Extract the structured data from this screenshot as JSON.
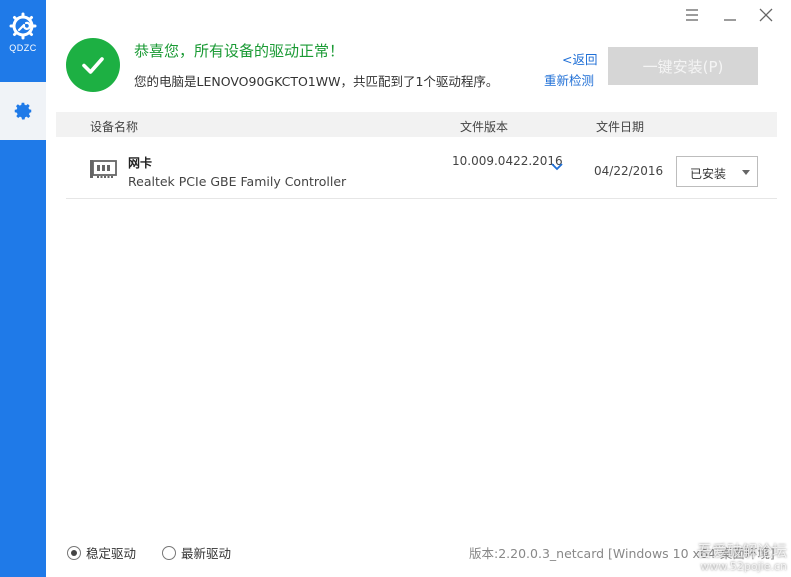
{
  "sidebar": {
    "logo_text": "QDZC",
    "nav": [
      {
        "icon": "gear-icon",
        "active": true
      }
    ]
  },
  "window_controls": [
    "menu-icon",
    "minimize-icon",
    "close-icon"
  ],
  "status": {
    "title": "恭喜您，所有设备的驱动正常！",
    "detail": "您的电脑是LENOVO90GKCTO1WW，共匹配到了1个驱动程序。"
  },
  "links": {
    "back": "<返回",
    "recheck": "重新检测"
  },
  "install_button": "一键安装(P)",
  "table": {
    "headers": {
      "name": "设备名称",
      "version": "文件版本",
      "date": "文件日期"
    },
    "rows": [
      {
        "type": "网卡",
        "name": "Realtek PCIe GBE Family Controller",
        "version": "10.009.0422.2016",
        "date": "04/22/2016",
        "status": "已安装"
      }
    ]
  },
  "footer": {
    "options": [
      {
        "label": "稳定驱动",
        "checked": true
      },
      {
        "label": "最新驱动",
        "checked": false
      }
    ],
    "version_info": "版本:2.20.0.3_netcard [Windows 10 x64 桌面环境]"
  },
  "watermark": {
    "line1": "吾爱破解论坛",
    "line2": "www.52pojie.cn"
  },
  "colors": {
    "sidebar": "#1f7ae8",
    "success": "#1db043",
    "link": "#1f6fd6",
    "button_disabled": "#d6d6d6"
  }
}
